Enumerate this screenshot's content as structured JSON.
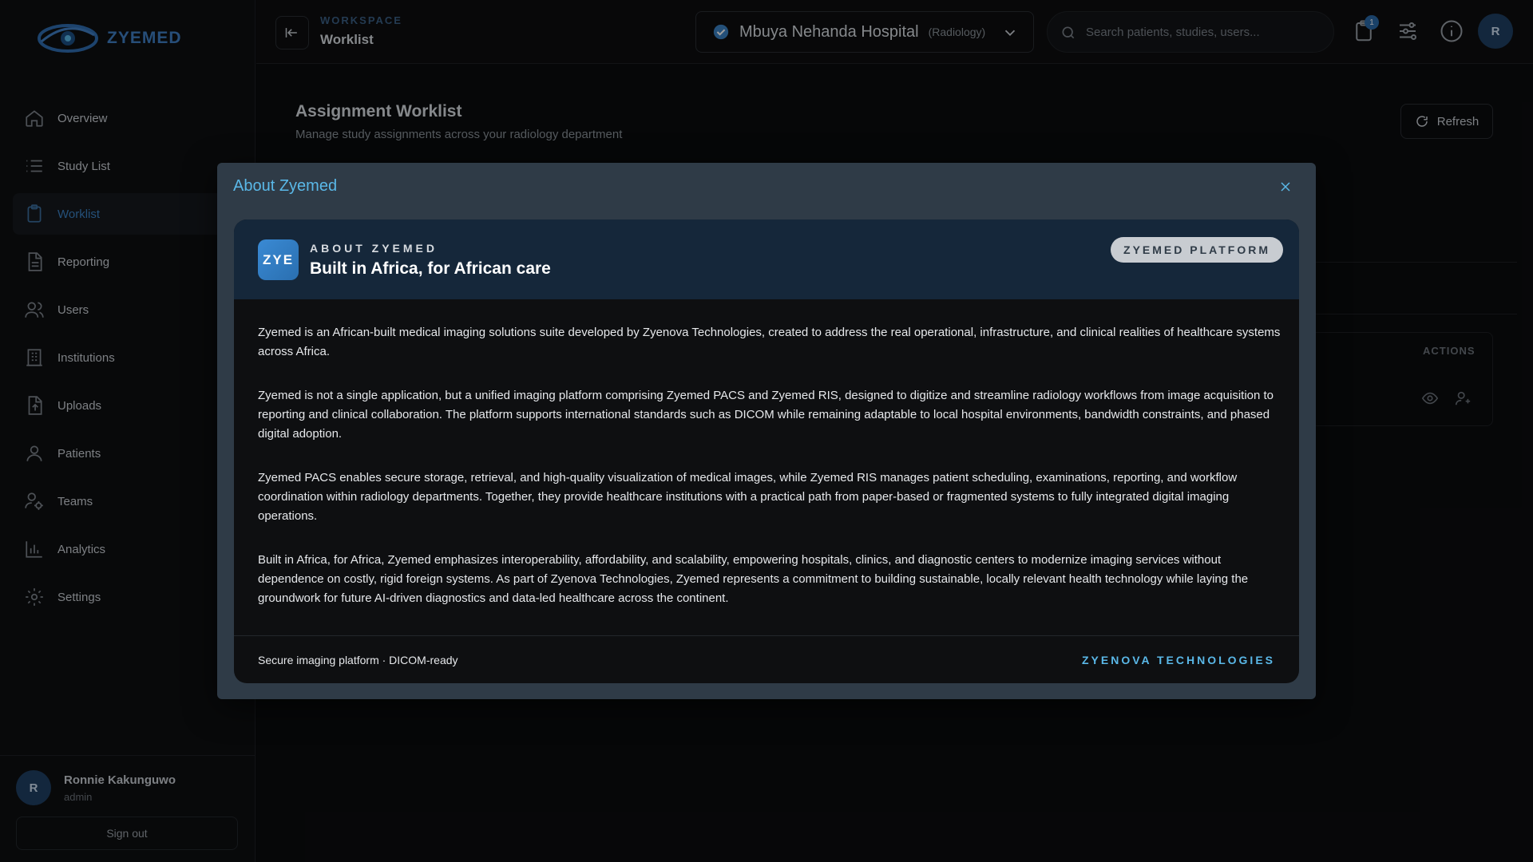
{
  "app": {
    "logo_text": "ZYEMED"
  },
  "sidebar": {
    "items": [
      {
        "label": "Overview",
        "icon": "home-icon"
      },
      {
        "label": "Study List",
        "icon": "list-icon"
      },
      {
        "label": "Worklist",
        "icon": "clipboard-icon",
        "active": true
      },
      {
        "label": "Reporting",
        "icon": "document-icon"
      },
      {
        "label": "Users",
        "icon": "users-icon"
      },
      {
        "label": "Institutions",
        "icon": "building-icon"
      },
      {
        "label": "Uploads",
        "icon": "upload-file-icon"
      },
      {
        "label": "Patients",
        "icon": "user-icon"
      },
      {
        "label": "Teams",
        "icon": "team-icon"
      },
      {
        "label": "Analytics",
        "icon": "bar-chart-icon"
      },
      {
        "label": "Settings",
        "icon": "gear-icon"
      }
    ],
    "user": {
      "initial": "R",
      "name": "Ronnie Kakunguwo",
      "role": "admin",
      "signout_label": "Sign out"
    }
  },
  "header": {
    "crumb_top": "WORKSPACE",
    "crumb_title": "Worklist",
    "hospital_name": "Mbuya Nehanda Hospital",
    "hospital_dept": "(Radiology)",
    "search_placeholder": "Search patients, studies, users...",
    "notification_count": "1",
    "avatar_initial": "R"
  },
  "page": {
    "title": "Assignment Worklist",
    "subtitle": "Manage study assignments across your radiology department",
    "refresh_label": "Refresh",
    "table_actions_header": "ACTIONS"
  },
  "modal": {
    "title": "About Zyemed",
    "badge_text": "ZYE",
    "eyebrow": "ABOUT ZYEMED",
    "card_title": "Built in Africa, for African care",
    "pill": "ZYEMED PLATFORM",
    "paragraphs": [
      "Zyemed is an African-built medical imaging solutions suite developed by Zyenova Technologies, created to address the real operational, infrastructure, and clinical realities of healthcare systems across Africa.",
      "Zyemed is not a single application, but a unified imaging platform comprising Zyemed PACS and Zyemed RIS, designed to digitize and streamline radiology workflows from image acquisition to reporting and clinical collaboration. The platform supports international standards such as DICOM while remaining adaptable to local hospital environments, bandwidth constraints, and phased digital adoption.",
      "Zyemed PACS enables secure storage, retrieval, and high-quality visualization of medical images, while Zyemed RIS manages patient scheduling, examinations, reporting, and workflow coordination within radiology departments. Together, they provide healthcare institutions with a practical path from paper-based or fragmented systems to fully integrated digital imaging operations.",
      "Built in Africa, for Africa, Zyemed emphasizes interoperability, affordability, and scalability, empowering hospitals, clinics, and diagnostic centers to modernize imaging services without dependence on costly, rigid foreign systems. As part of Zyenova Technologies, Zyemed represents a commitment to building sustainable, locally relevant health technology while laying the groundwork for future AI-driven diagnostics and data-led healthcare across the continent."
    ],
    "footer_left": "Secure imaging platform · DICOM-ready",
    "footer_right": "ZYENOVA TECHNOLOGIES"
  },
  "colors": {
    "accent": "#5ab8e8",
    "brand": "#3f7fc4",
    "active_nav": "#3b82c4"
  }
}
